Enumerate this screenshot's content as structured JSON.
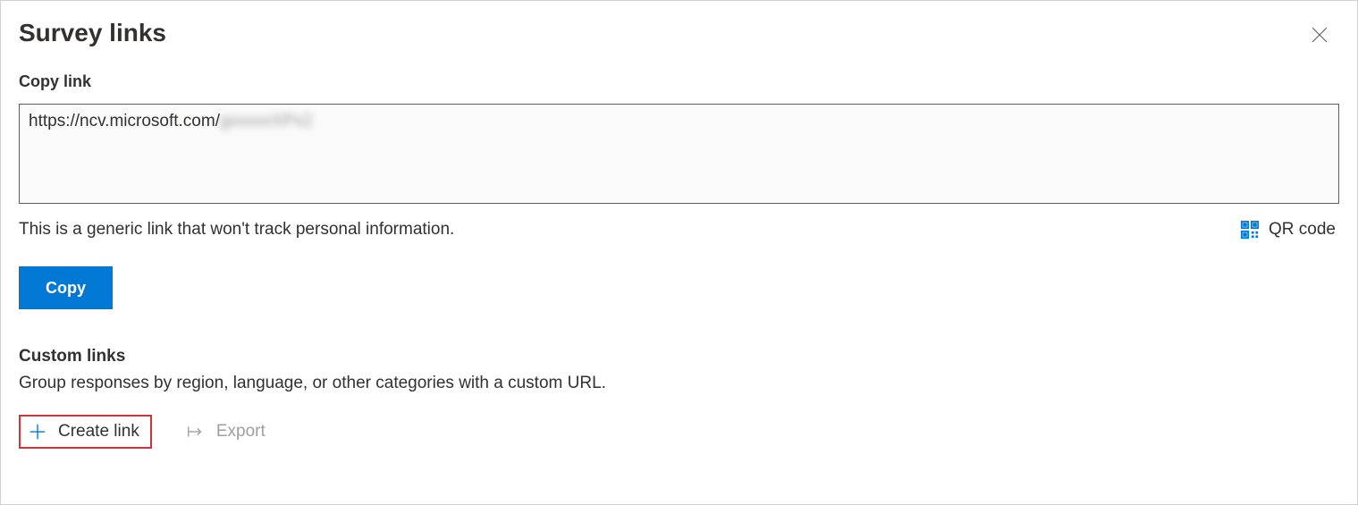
{
  "header": {
    "title": "Survey links"
  },
  "copyLink": {
    "label": "Copy link",
    "urlVisible": "https://ncv.microsoft.com/",
    "urlBlurred": "gxxxxxXPx2",
    "helper": "This is a generic link that won't track personal information.",
    "qrLabel": "QR code",
    "copyButton": "Copy"
  },
  "customLinks": {
    "label": "Custom links",
    "description": "Group responses by region, language, or other categories with a custom URL.",
    "createLink": "Create link",
    "export": "Export"
  }
}
